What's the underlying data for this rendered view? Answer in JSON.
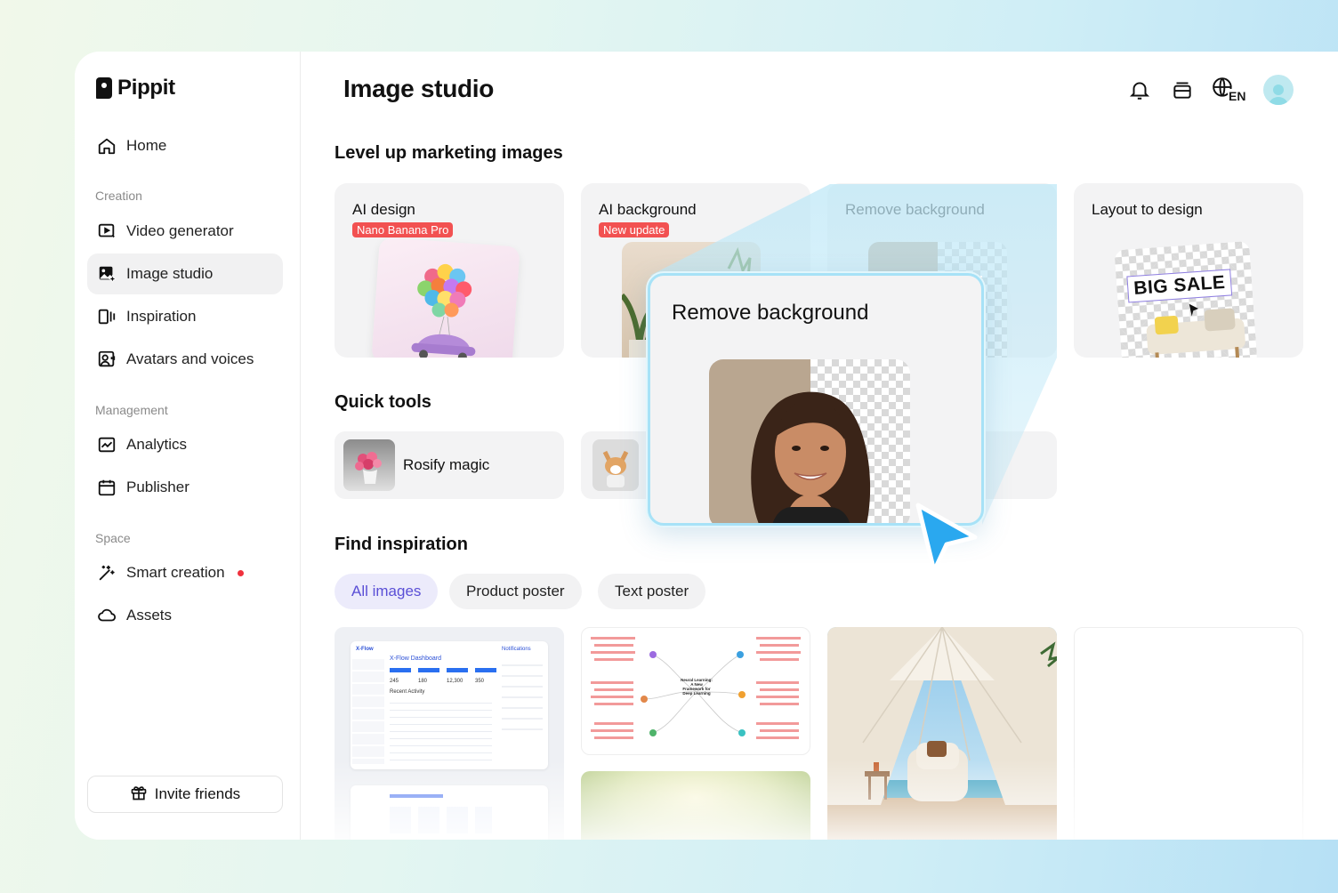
{
  "app": {
    "name": "Pippit"
  },
  "sidebar": {
    "home": "Home",
    "sections": {
      "creation": "Creation",
      "management": "Management",
      "space": "Space"
    },
    "items": [
      {
        "label": "Video generator"
      },
      {
        "label": "Image studio",
        "active": true
      },
      {
        "label": "Inspiration"
      },
      {
        "label": "Avatars and voices"
      },
      {
        "label": "Analytics"
      },
      {
        "label": "Publisher"
      },
      {
        "label": "Smart creation",
        "dot": true
      },
      {
        "label": "Assets"
      }
    ],
    "invite": "Invite friends"
  },
  "header": {
    "title": "Image studio",
    "language": "EN"
  },
  "marketing": {
    "title": "Level up marketing images",
    "cards": [
      {
        "title": "AI design",
        "badge": "Nano Banana Pro"
      },
      {
        "title": "AI background",
        "badge": "New update"
      },
      {
        "title": "Remove background"
      },
      {
        "title": "Layout to design",
        "thumb_text": "BIG SALE"
      }
    ]
  },
  "quick_tools": {
    "title": "Quick tools",
    "items": [
      {
        "label": "Rosify magic"
      }
    ]
  },
  "inspiration": {
    "title": "Find inspiration",
    "chips": [
      {
        "label": "All images",
        "active": true
      },
      {
        "label": "Product poster"
      },
      {
        "label": "Text poster"
      }
    ],
    "dashboard": {
      "brand": "X-Flow",
      "title": "X-Flow Dashboard",
      "stats": [
        "245",
        "180",
        "12,300",
        "350"
      ],
      "notifications": "Notifications",
      "recent": "Recent Activity"
    },
    "mindmap_center": "Neural Learning: A New Framework for Deep Learning"
  },
  "popup": {
    "title": "Remove background"
  },
  "colors": {
    "accent": "#5a4fd6",
    "badge": "#f25151",
    "popup_border": "#a7e2f7",
    "cursor": "#2aa8ef"
  }
}
